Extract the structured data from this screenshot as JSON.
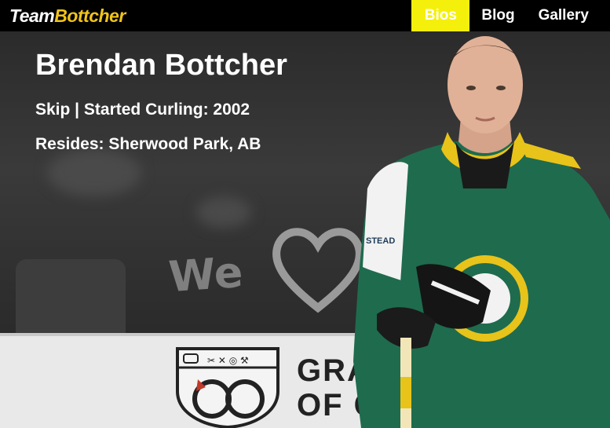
{
  "header": {
    "logo_team": "Team",
    "logo_bottcher": "Bottcher",
    "nav": [
      {
        "label": "Bios",
        "active": true
      },
      {
        "label": "Blog",
        "active": false
      },
      {
        "label": "Gallery",
        "active": false
      }
    ]
  },
  "bio": {
    "name": "Brendan Bottcher",
    "role_line": "Skip | Started Curling: 2002",
    "residence_line": "Resides: Sherwood Park, AB"
  },
  "background": {
    "banner_text": "We",
    "boards_text_line1": "GRAN",
    "boards_text_line2": "OF CUR",
    "jersey_sponsor": "STEAD"
  },
  "colors": {
    "header_bg": "#000000",
    "active_nav_bg": "#f4f00c",
    "logo_accent": "#f0c419",
    "jersey_green": "#1f6b4e",
    "jersey_gold": "#e8c31a"
  }
}
